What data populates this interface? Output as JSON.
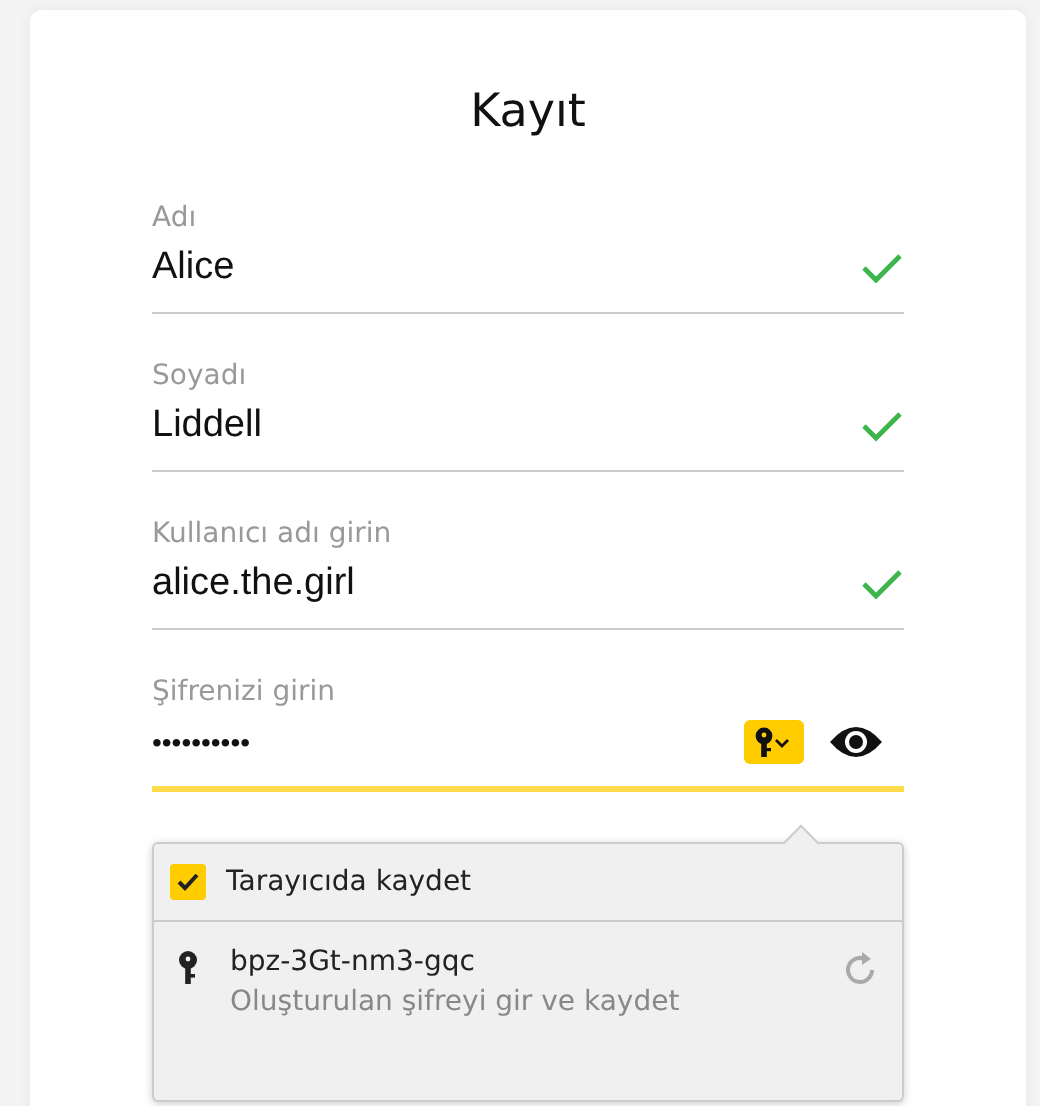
{
  "title": "Kayıt",
  "fields": [
    {
      "kind": "text",
      "label": "Adı",
      "value": "Alice",
      "valid": true,
      "focused": false
    },
    {
      "kind": "text",
      "label": "Soyadı",
      "value": "Liddell",
      "valid": true,
      "focused": false
    },
    {
      "kind": "text",
      "label": "Kullanıcı adı girin",
      "value": "alice.the.girl",
      "valid": true,
      "focused": false
    },
    {
      "kind": "password",
      "label": "Şifrenizi girin",
      "value": "••••••••••",
      "valid": false,
      "focused": true
    }
  ],
  "popup": {
    "save": {
      "label": "Tarayıcıda kaydet",
      "checked": true
    },
    "suggestion": {
      "password": "bpz-3Gt-nm3-gqc",
      "hint": "Oluşturulan şifreyi gir ve kaydet"
    }
  }
}
